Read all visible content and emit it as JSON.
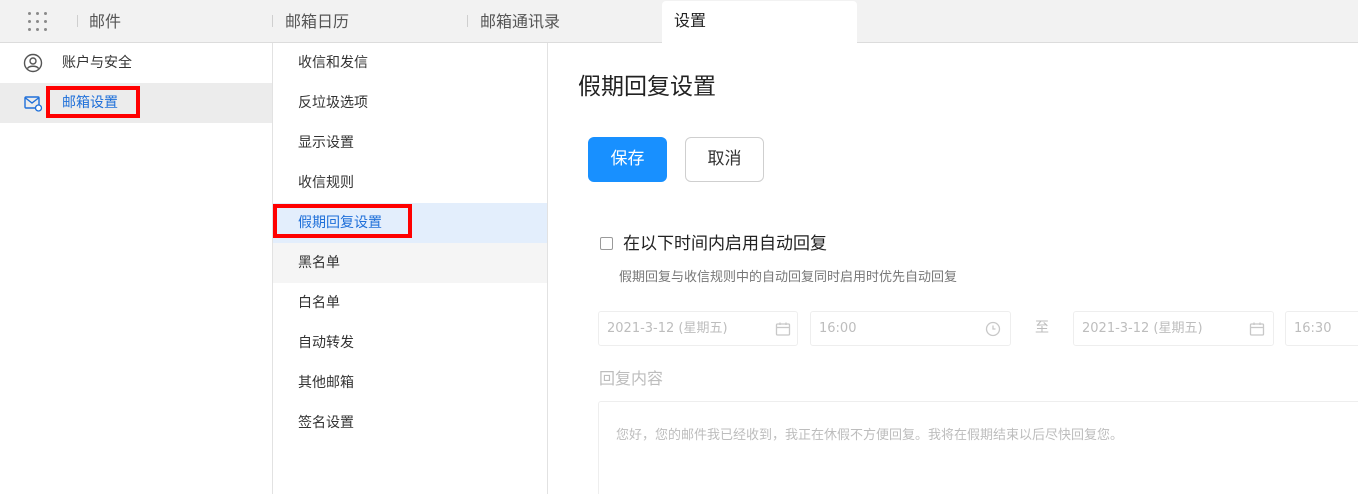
{
  "topbar": {
    "tabs": [
      {
        "label": "邮件"
      },
      {
        "label": "邮箱日历"
      },
      {
        "label": "邮箱通讯录"
      },
      {
        "label": "设置"
      }
    ]
  },
  "sidebar": {
    "items": [
      {
        "label": "账户与安全",
        "icon": "user-circle-icon"
      },
      {
        "label": "邮箱设置",
        "icon": "mail-settings-icon"
      }
    ]
  },
  "submenu": {
    "items": [
      {
        "label": "收信和发信"
      },
      {
        "label": "反垃圾选项"
      },
      {
        "label": "显示设置"
      },
      {
        "label": "收信规则"
      },
      {
        "label": "假期回复设置"
      },
      {
        "label": "黑名单"
      },
      {
        "label": "白名单"
      },
      {
        "label": "自动转发"
      },
      {
        "label": "其他邮箱"
      },
      {
        "label": "签名设置"
      }
    ]
  },
  "content": {
    "title": "假期回复设置",
    "save_label": "保存",
    "cancel_label": "取消",
    "enable_label": "在以下时间内启用自动回复",
    "enable_checked": false,
    "hint": "假期回复与收信规则中的自动回复同时启用时优先自动回复",
    "start_date": "2021-3-12 (星期五)",
    "start_time": "16:00",
    "to_label": "至",
    "end_date": "2021-3-12 (星期五)",
    "end_time": "16:30",
    "reply_label": "回复内容",
    "reply_text": "您好，您的邮件我已经收到，我正在休假不方便回复。我将在假期结束以后尽快回复您。"
  },
  "colors": {
    "accent": "#1890ff",
    "active_text": "#1e6fd9",
    "highlight_box": "#ff0000"
  }
}
